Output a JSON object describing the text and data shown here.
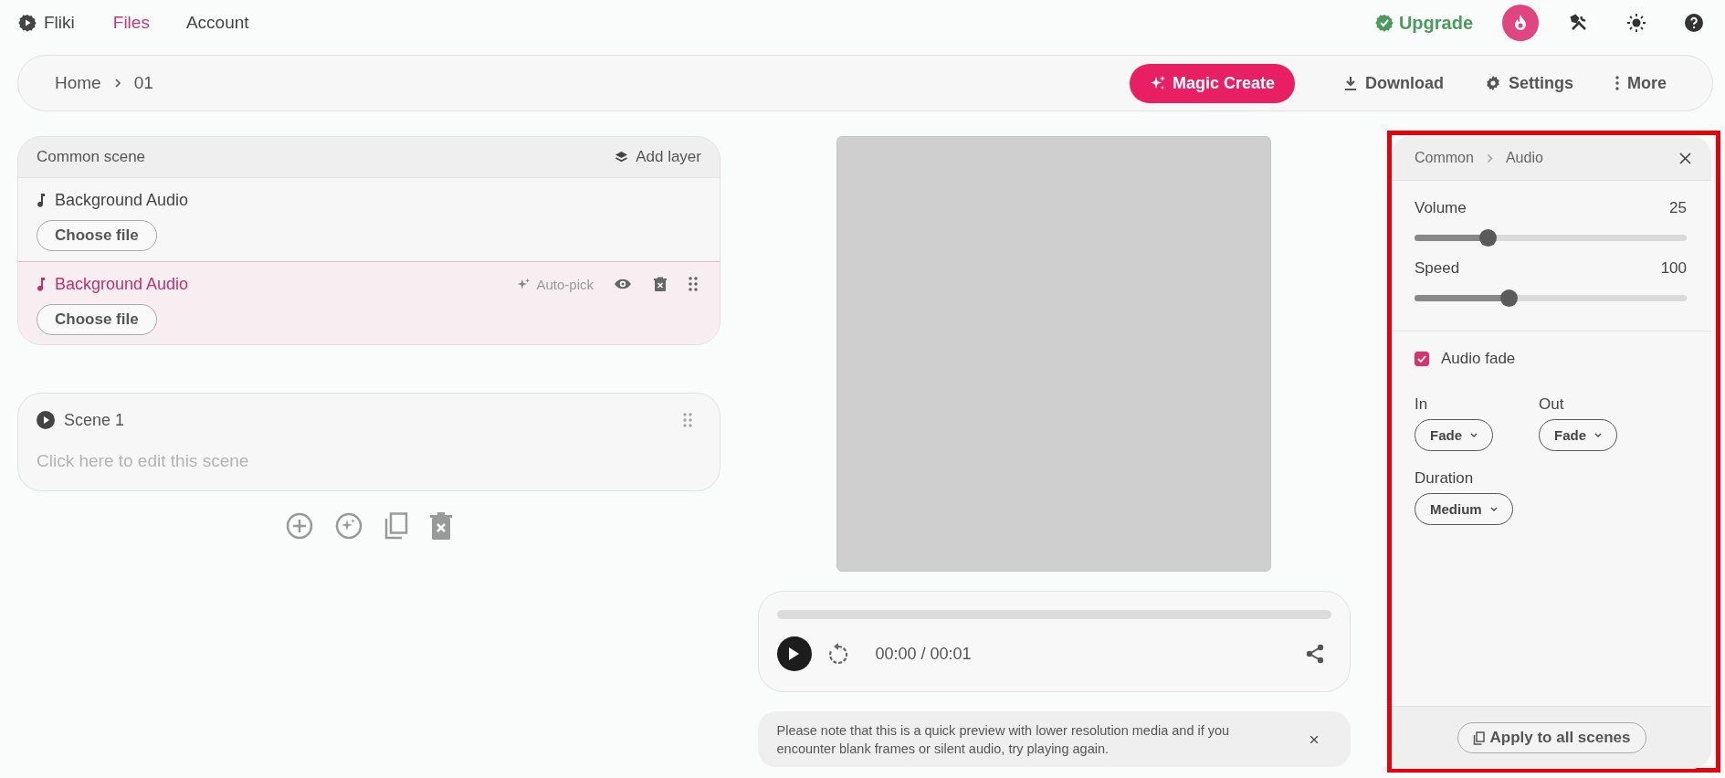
{
  "nav": {
    "brand": "Fliki",
    "items": [
      {
        "label": "Files",
        "selected": true
      },
      {
        "label": "Account",
        "selected": false
      }
    ],
    "upgrade": "Upgrade"
  },
  "toolbar": {
    "breadcrumb": [
      "Home",
      "01"
    ],
    "actions": [
      {
        "kind": "primary",
        "label": "Magic Create"
      },
      {
        "kind": "download",
        "label": "Download"
      },
      {
        "kind": "settings",
        "label": "Settings"
      },
      {
        "kind": "more",
        "label": "More"
      }
    ]
  },
  "common_scene": {
    "title": "Common scene",
    "add_layer": "Add layer",
    "layers": [
      {
        "name": "Background Audio",
        "button": "Choose file",
        "selected": false
      },
      {
        "name": "Background Audio",
        "button": "Choose file",
        "selected": true,
        "auto_pick": "Auto-pick"
      }
    ]
  },
  "scene": {
    "title": "Scene 1",
    "placeholder": "Click here to edit this scene"
  },
  "player": {
    "time": "00:00 / 00:01"
  },
  "notice": {
    "text": "Please note that this is a quick preview with lower resolution media and if you encounter blank frames or silent audio, try playing again."
  },
  "panel": {
    "breadcrumb": [
      "Common",
      "Audio"
    ],
    "sliders": [
      {
        "label": "Volume",
        "reading": "25",
        "level": 0.27
      },
      {
        "label": "Speed",
        "reading": "100",
        "level": 0.345
      }
    ],
    "fade": {
      "label": "Audio fade",
      "checked": true
    },
    "dropdowns": [
      {
        "label": "In",
        "value": "Fade"
      },
      {
        "label": "Out",
        "value": "Fade"
      }
    ],
    "duration": {
      "label": "Duration",
      "value": "Medium"
    },
    "apply": "Apply to all scenes"
  }
}
